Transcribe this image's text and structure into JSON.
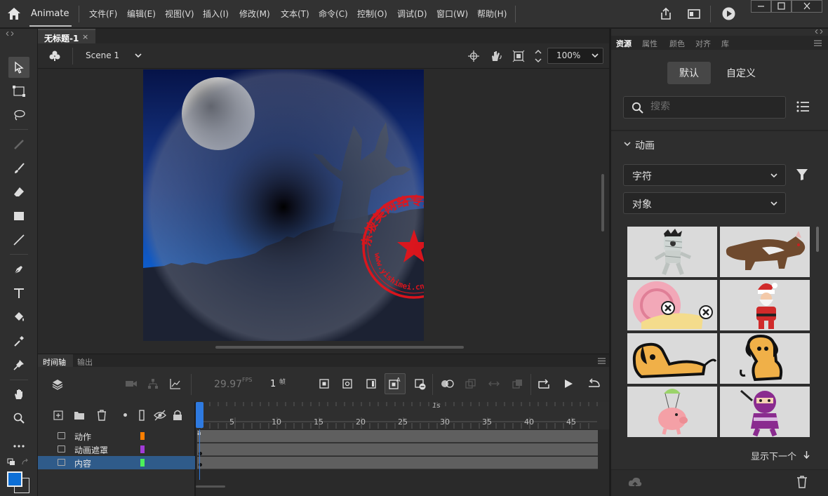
{
  "app": {
    "name": "Animate",
    "menu": [
      "文件(F)",
      "编辑(E)",
      "视图(V)",
      "插入(I)",
      "修改(M)",
      "文本(T)",
      "命令(C)",
      "控制(O)",
      "调试(D)",
      "窗口(W)",
      "帮助(H)"
    ]
  },
  "document": {
    "tab_title": "无标题-1",
    "tab_close": "×",
    "scene": "Scene 1",
    "zoom": "100%"
  },
  "stage": {
    "watermark_text": "东坡美网络专用章",
    "watermark_url": "www.yishimei.cn"
  },
  "timeline": {
    "tabs": [
      "时间轴",
      "输出"
    ],
    "fps": "29.97",
    "fps_unit": "FPS",
    "frame": "1",
    "frame_unit": "帧",
    "second_marker": "1s",
    "ticks": [
      "5",
      "10",
      "15",
      "20",
      "25",
      "30",
      "35",
      "40",
      "45"
    ],
    "layers": [
      {
        "name": "动作",
        "color": "#ff7f00",
        "selected": false
      },
      {
        "name": "动画遮罩",
        "color": "#a23bd8",
        "selected": false
      },
      {
        "name": "内容",
        "color": "#4cf05a",
        "selected": true
      }
    ],
    "first_keyframe_label": "a"
  },
  "right_panel": {
    "tabs": [
      "资源",
      "属性",
      "颜色",
      "对齐",
      "库"
    ],
    "active_tab": "资源",
    "segment": [
      "默认",
      "自定义"
    ],
    "search_placeholder": "搜索",
    "section_title": "动画",
    "dropdown1": "字符",
    "dropdown2": "对象",
    "show_next": "显示下一个"
  },
  "colors": {
    "accent_blue": "#0d6fd6",
    "fill_swatch": "#0d6fd6",
    "selected_layer": "#2f5b8a",
    "stamp_red": "#e3141b"
  }
}
